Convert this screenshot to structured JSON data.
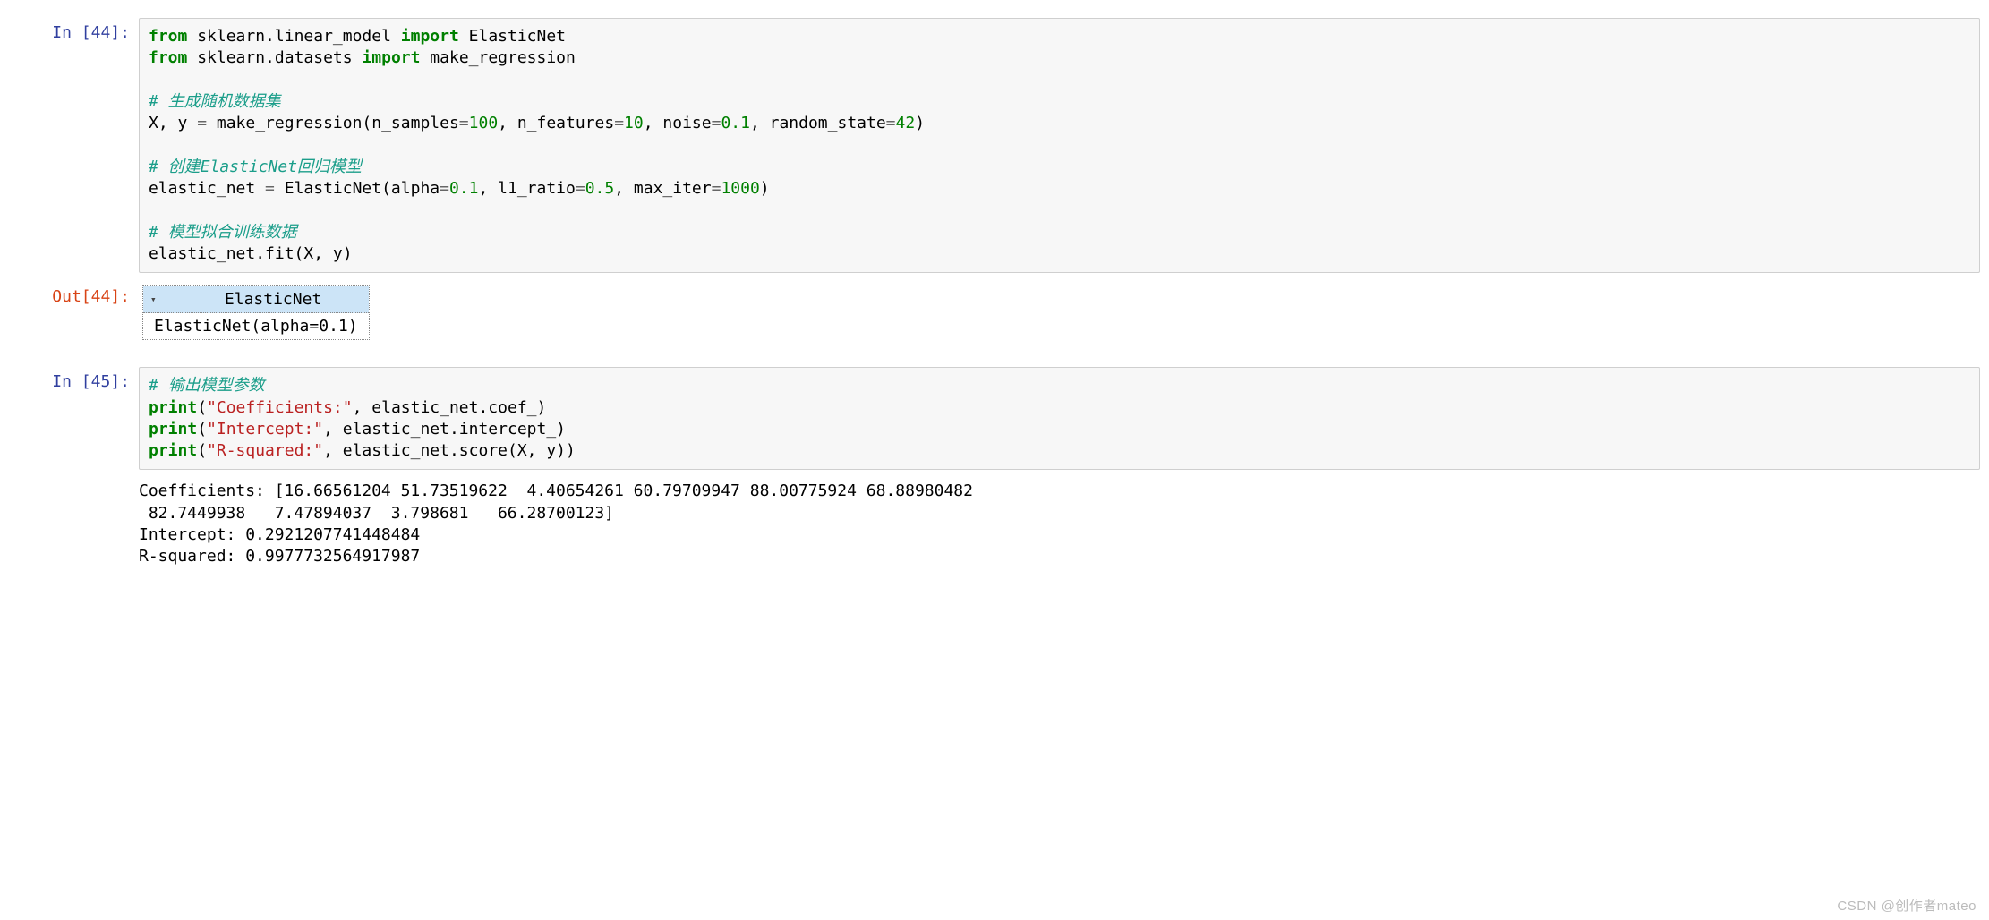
{
  "cells": {
    "c44_prompt": "In [44]:",
    "c44_out_prompt": "Out[44]:",
    "c45_prompt": "In [45]:"
  },
  "code44": {
    "l1": {
      "kw1": "from",
      "mod1": " sklearn.linear_model ",
      "kw2": "import",
      "name": " ElasticNet"
    },
    "l2": {
      "kw1": "from",
      "mod1": " sklearn.datasets ",
      "kw2": "import",
      "name": " make_regression"
    },
    "l3": "",
    "l4_comment": "# 生成随机数据集",
    "l5": {
      "pre": "X, y ",
      "eq": "=",
      "post": " make_regression(n_samples",
      "eq2": "=",
      "n1": "100",
      "c1": ", n_features",
      "eq3": "=",
      "n2": "10",
      "c2": ", noise",
      "eq4": "=",
      "n3": "0.1",
      "c3": ", random_state",
      "eq5": "=",
      "n4": "42",
      "end": ")"
    },
    "l6": "",
    "l7_comment": "# 创建ElasticNet回归模型",
    "l8": {
      "pre": "elastic_net ",
      "eq": "=",
      "post": " ElasticNet(alpha",
      "eq2": "=",
      "n1": "0.1",
      "c1": ", l1_ratio",
      "eq3": "=",
      "n2": "0.5",
      "c2": ", max_iter",
      "eq4": "=",
      "n3": "1000",
      "end": ")"
    },
    "l9": "",
    "l10_comment": "# 模型拟合训练数据",
    "l11": "elastic_net.fit(X, y)",
    "l12": ""
  },
  "out44": {
    "header": "ElasticNet",
    "body": "ElasticNet(alpha=0.1)"
  },
  "code45": {
    "l1_comment": "# 输出模型参数",
    "l2": {
      "fn": "print",
      "op": "(",
      "s": "\"Coefficients:\"",
      "rest": ", elastic_net.coef_)"
    },
    "l3": {
      "fn": "print",
      "op": "(",
      "s": "\"Intercept:\"",
      "rest": ", elastic_net.intercept_)"
    },
    "l4": {
      "fn": "print",
      "op": "(",
      "s": "\"R-squared:\"",
      "rest": ", elastic_net.score(X, y))"
    },
    "l5": ""
  },
  "out45": {
    "text": "Coefficients: [16.66561204 51.73519622  4.40654261 60.79709947 88.00775924 68.88980482\n 82.7449938   7.47894037  3.798681   66.28700123]\nIntercept: 0.2921207741448484\nR-squared: 0.9977732564917987"
  },
  "watermark": "CSDN @创作者mateo"
}
